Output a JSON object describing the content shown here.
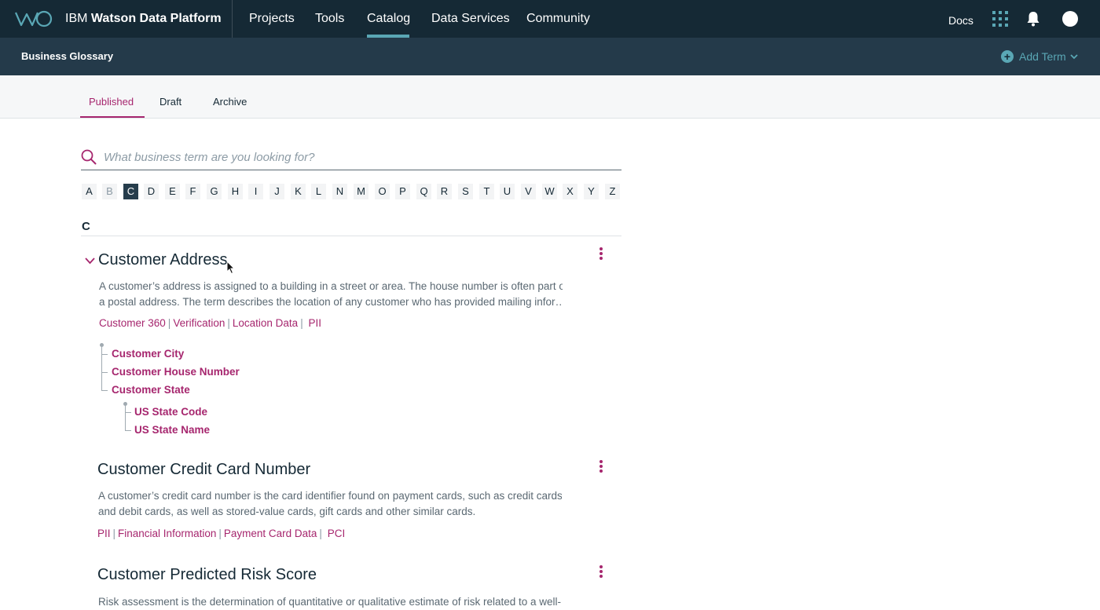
{
  "brand": {
    "company": "IBM",
    "product": "Watson Data Platform"
  },
  "nav": {
    "items": [
      "Projects",
      "Tools",
      "Catalog",
      "Data Services",
      "Community"
    ],
    "active": "Catalog",
    "docs": "Docs"
  },
  "icons": {
    "apps": "apps-grid-icon",
    "notifications": "bell-icon",
    "user": "avatar",
    "search": "search-icon",
    "expand": "chevron-down-icon",
    "more": "overflow-menu-icon"
  },
  "subheader": {
    "title": "Business Glossary",
    "add_term": "Add Term"
  },
  "tabs": [
    {
      "label": "Published",
      "active": true
    },
    {
      "label": "Draft",
      "active": false
    },
    {
      "label": "Archive",
      "active": false
    }
  ],
  "search": {
    "placeholder": "What business term are you looking for?",
    "value": ""
  },
  "alphabet": {
    "letters": [
      "A",
      "B",
      "C",
      "D",
      "E",
      "F",
      "G",
      "H",
      "I",
      "J",
      "K",
      "L",
      "N",
      "M",
      "O",
      "P",
      "Q",
      "R",
      "S",
      "T",
      "U",
      "V",
      "W",
      "X",
      "Y",
      "Z"
    ],
    "active": "C",
    "disabled": [
      "B"
    ]
  },
  "section": {
    "letter": "C"
  },
  "terms": [
    {
      "title": "Customer Address",
      "expanded": true,
      "description_lines": [
        "A customer’s address is assigned to a building in a street or area. The house number is often part of",
        "a postal address. The term describes the location of any customer who has provided mailing infor…"
      ],
      "tags": [
        "Customer 360",
        "Verification",
        "Location Data",
        "PII"
      ],
      "children": [
        "Customer City",
        "Customer House Number",
        "Customer State"
      ],
      "grandchildren": [
        "US State Code",
        "US State Name"
      ]
    },
    {
      "title": "Customer Credit Card Number",
      "description_lines": [
        "A customer’s credit card number is the card identifier found on payment cards, such as credit cards",
        "and debit cards, as well as stored-value cards, gift cards and other similar cards."
      ],
      "tags": [
        "PII",
        "Financial Information",
        "Payment Card Data",
        "PCI"
      ]
    },
    {
      "title": "Customer Predicted Risk Score",
      "description_lines": [
        "Risk assessment is the determination of quantitative or qualitative estimate of risk related to a well-"
      ]
    }
  ],
  "colors": {
    "nav_bg": "#152935",
    "subheader_bg": "#243a4a",
    "accent_teal": "#5aa7b5",
    "link_magenta": "#a6266e"
  }
}
